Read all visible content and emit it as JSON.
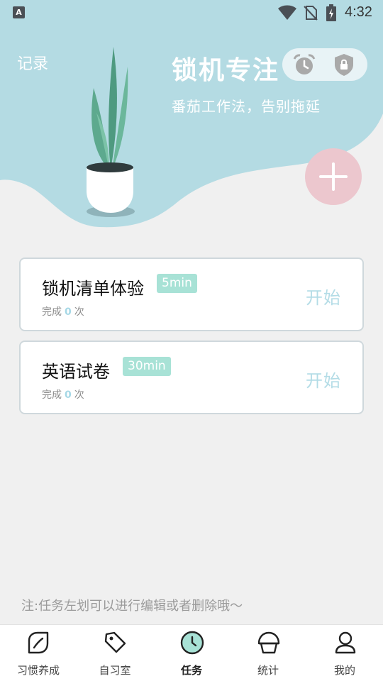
{
  "status_bar": {
    "time": "4:32",
    "left_icon_letter": "A",
    "icons": [
      "app-a-icon",
      "wifi-icon",
      "no-sim-icon",
      "battery-charging-icon"
    ]
  },
  "header": {
    "records_link": "记录",
    "title": "锁机专注",
    "subtitle": "番茄工作法，告别拖延",
    "mode_icons": [
      "alarm-clock-icon",
      "shield-lock-icon"
    ],
    "add_button_icon": "plus-icon",
    "colors": {
      "header_bg": "#b4dbe3",
      "add_button": "#ecc7ce",
      "badge": "#a8e2d6",
      "start_text": "#b3dce6"
    }
  },
  "tasks": [
    {
      "name": "锁机清单体验",
      "duration": "5min",
      "done_prefix": "完成",
      "done_count": "0",
      "done_suffix": "次",
      "start_label": "开始"
    },
    {
      "name": "英语试卷",
      "duration": "30min",
      "done_prefix": "完成",
      "done_count": "0",
      "done_suffix": "次",
      "start_label": "开始"
    }
  ],
  "hint": "注:任务左划可以进行编辑或者删除哦～",
  "bottom_nav": {
    "active": "任务",
    "items": [
      {
        "label": "习惯养成",
        "icon": "leaf-icon"
      },
      {
        "label": "自习室",
        "icon": "tag-icon"
      },
      {
        "label": "任务",
        "icon": "clock-icon"
      },
      {
        "label": "统计",
        "icon": "cupcake-icon"
      },
      {
        "label": "我的",
        "icon": "person-icon"
      }
    ]
  }
}
